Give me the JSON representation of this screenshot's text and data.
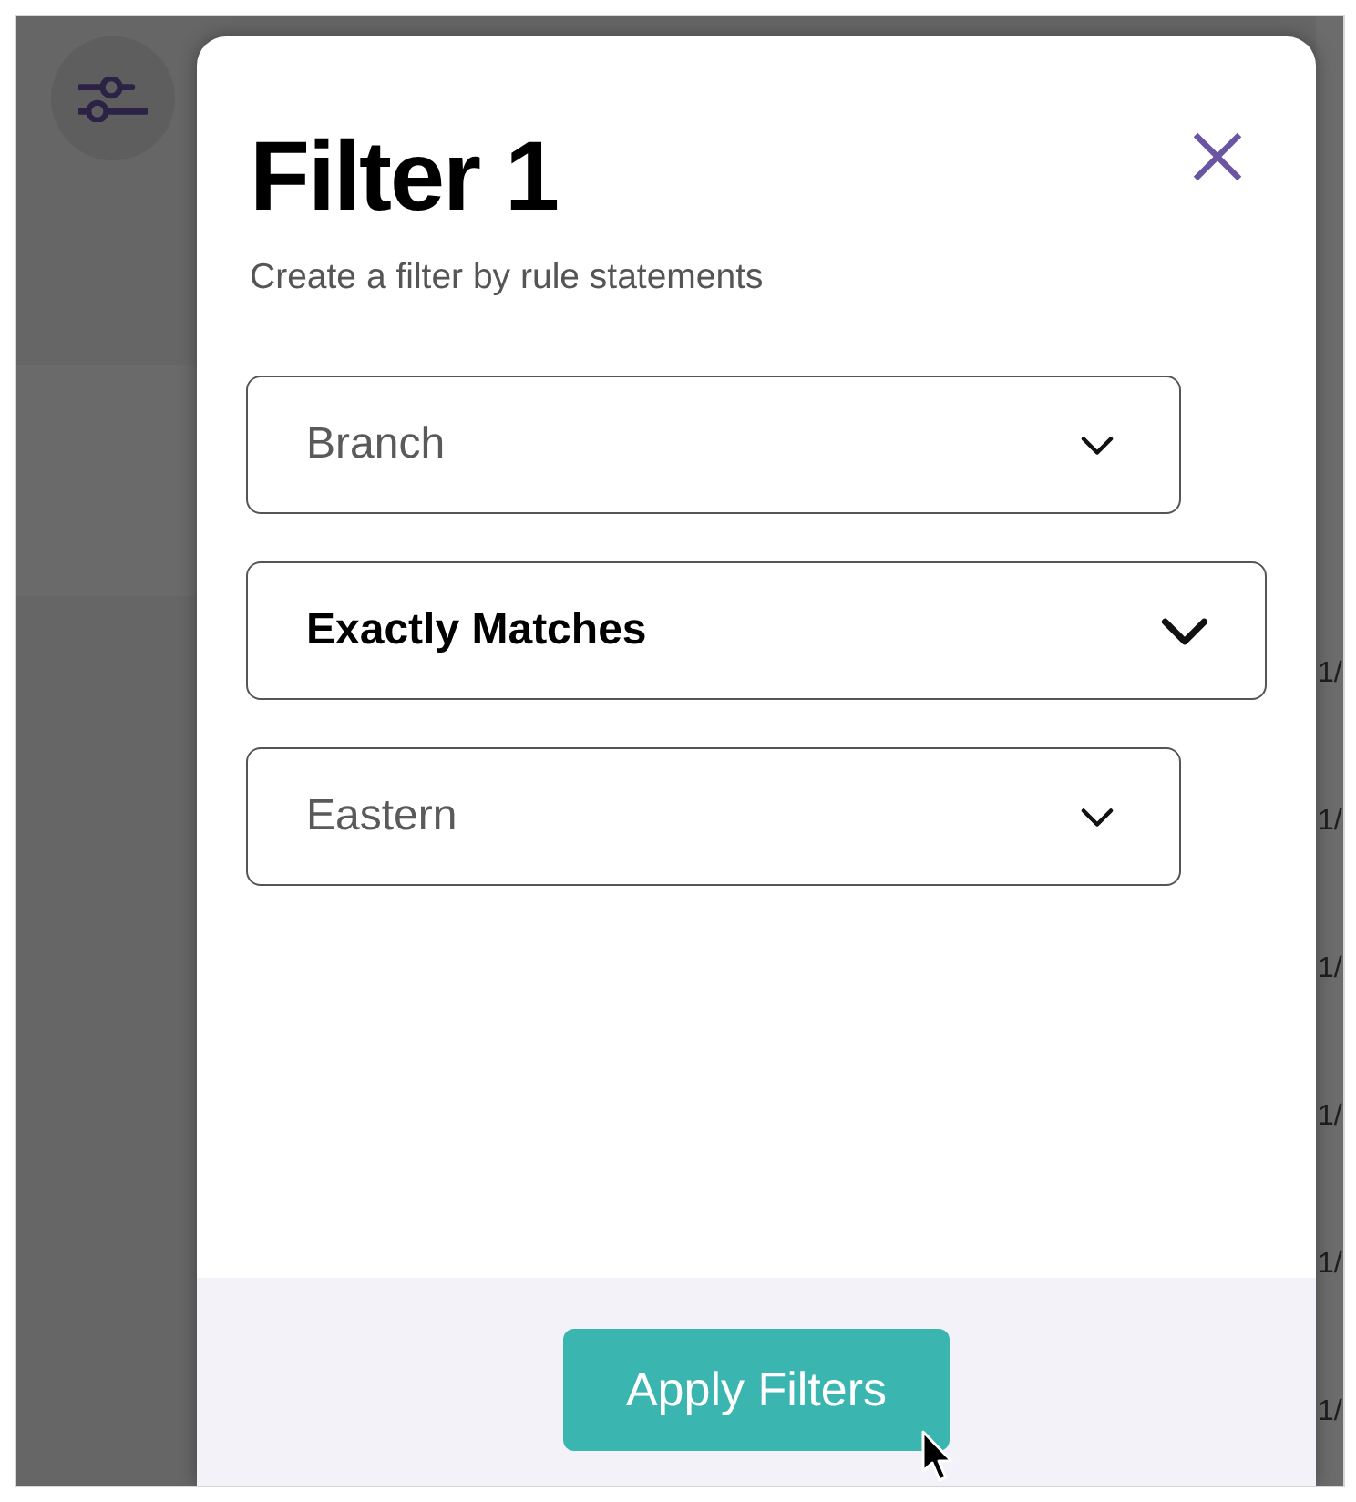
{
  "background": {
    "column_1": [
      "1/",
      "1/",
      "1/",
      "1/",
      "1/",
      "1/"
    ]
  },
  "dialog": {
    "title": "Filter 1",
    "subtitle": "Create a filter by rule statements",
    "fields": [
      {
        "value": "Branch",
        "active": false
      },
      {
        "value": "Exactly Matches",
        "active": true
      },
      {
        "value": "Eastern",
        "active": false
      }
    ],
    "apply_button": "Apply Filters"
  }
}
